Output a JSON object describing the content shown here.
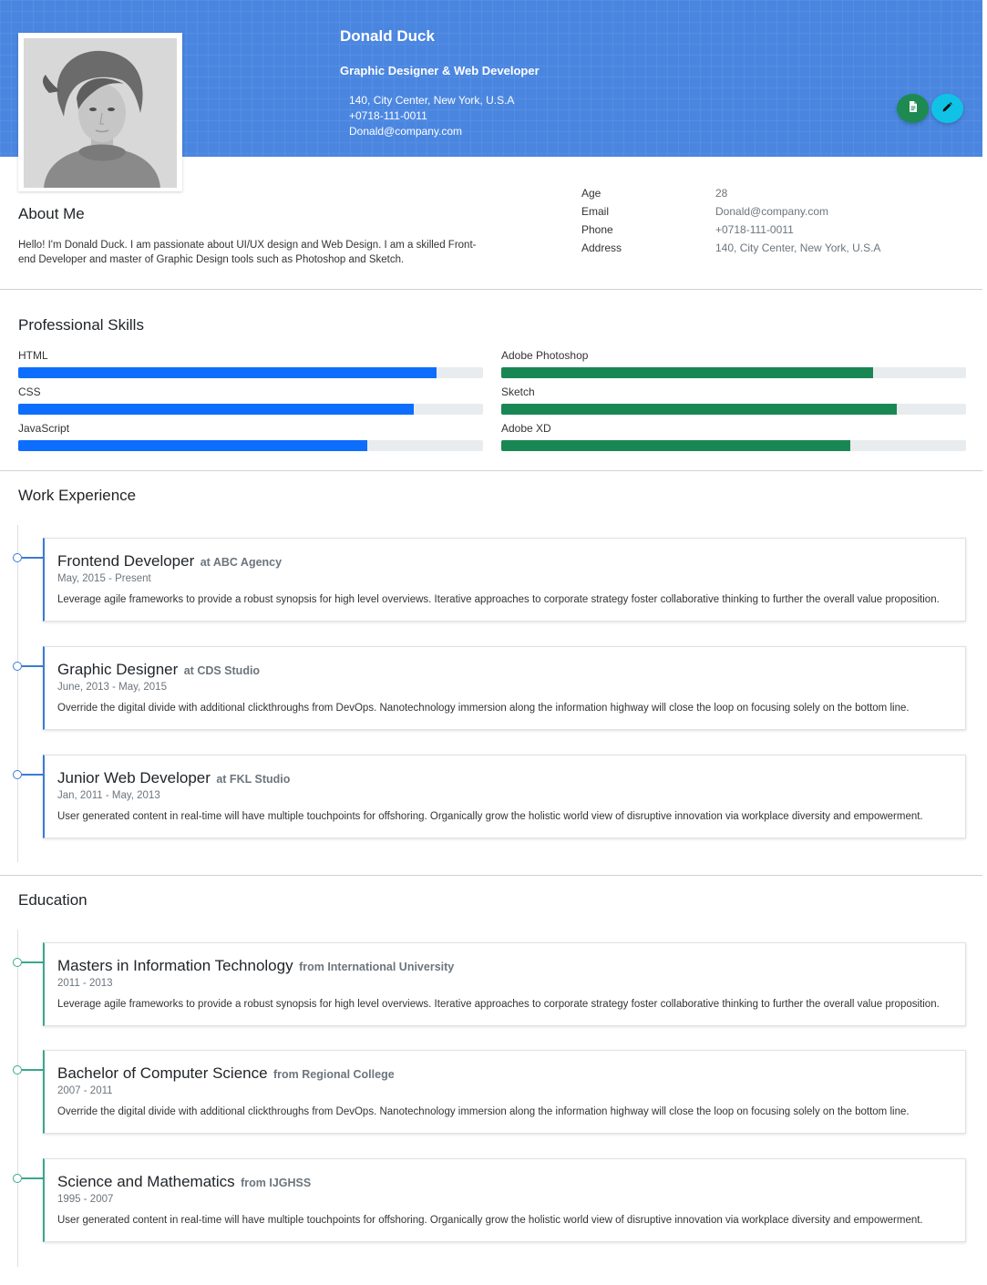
{
  "profile": {
    "name": "Donald Duck",
    "role": "Graphic Designer & Web Developer",
    "address": "140, City Center, New York, U.S.A",
    "phone": "+0718-111-0011",
    "email": "Donald@company.com"
  },
  "actions": {
    "download_icon": "document-icon",
    "edit_icon": "pencil-icon"
  },
  "colors": {
    "header": "#4a86e0",
    "skill_blue": "#0d6efd",
    "skill_green": "#198754",
    "work_accent": "#3a7bd5",
    "edu_accent": "#3aa68f"
  },
  "about": {
    "title": "About Me",
    "text": "Hello! I'm Donald Duck. I am passionate about UI/UX design and Web Design. I am a skilled Front-end Developer and master of Graphic Design tools such as Photoshop and Sketch."
  },
  "info": [
    {
      "label": "Age",
      "value": "28"
    },
    {
      "label": "Email",
      "value": "Donald@company.com"
    },
    {
      "label": "Phone",
      "value": "+0718-111-0011"
    },
    {
      "label": "Address",
      "value": "140, City Center, New York, U.S.A"
    }
  ],
  "skills": {
    "title": "Professional Skills",
    "left": [
      {
        "name": "HTML",
        "level": 0.9
      },
      {
        "name": "CSS",
        "level": 0.85
      },
      {
        "name": "JavaScript",
        "level": 0.75
      }
    ],
    "right": [
      {
        "name": "Adobe Photoshop",
        "level": 0.8
      },
      {
        "name": "Sketch",
        "level": 0.85
      },
      {
        "name": "Adobe XD",
        "level": 0.75
      }
    ]
  },
  "work": {
    "title": "Work Experience",
    "items": [
      {
        "title": "Frontend Developer",
        "at": "at ABC Agency",
        "date": "May, 2015 - Present",
        "desc": "Leverage agile frameworks to provide a robust synopsis for high level overviews. Iterative approaches to corporate strategy foster collaborative thinking to further the overall value proposition."
      },
      {
        "title": "Graphic Designer",
        "at": "at CDS Studio",
        "date": "June, 2013 - May, 2015",
        "desc": "Override the digital divide with additional clickthroughs from DevOps. Nanotechnology immersion along the information highway will close the loop on focusing solely on the bottom line."
      },
      {
        "title": "Junior Web Developer",
        "at": "at FKL Studio",
        "date": "Jan, 2011 - May, 2013",
        "desc": "User generated content in real-time will have multiple touchpoints for offshoring. Organically grow the holistic world view of disruptive innovation via workplace diversity and empowerment."
      }
    ]
  },
  "education": {
    "title": "Education",
    "items": [
      {
        "title": "Masters in Information Technology",
        "at": "from International University",
        "date": "2011 - 2013",
        "desc": "Leverage agile frameworks to provide a robust synopsis for high level overviews. Iterative approaches to corporate strategy foster collaborative thinking to further the overall value proposition."
      },
      {
        "title": "Bachelor of Computer Science",
        "at": "from Regional College",
        "date": "2007 - 2011",
        "desc": "Override the digital divide with additional clickthroughs from DevOps. Nanotechnology immersion along the information highway will close the loop on focusing solely on the bottom line."
      },
      {
        "title": "Science and Mathematics",
        "at": "from IJGHSS",
        "date": "1995 - 2007",
        "desc": "User generated content in real-time will have multiple touchpoints for offshoring. Organically grow the holistic world view of disruptive innovation via workplace diversity and empowerment."
      }
    ]
  }
}
